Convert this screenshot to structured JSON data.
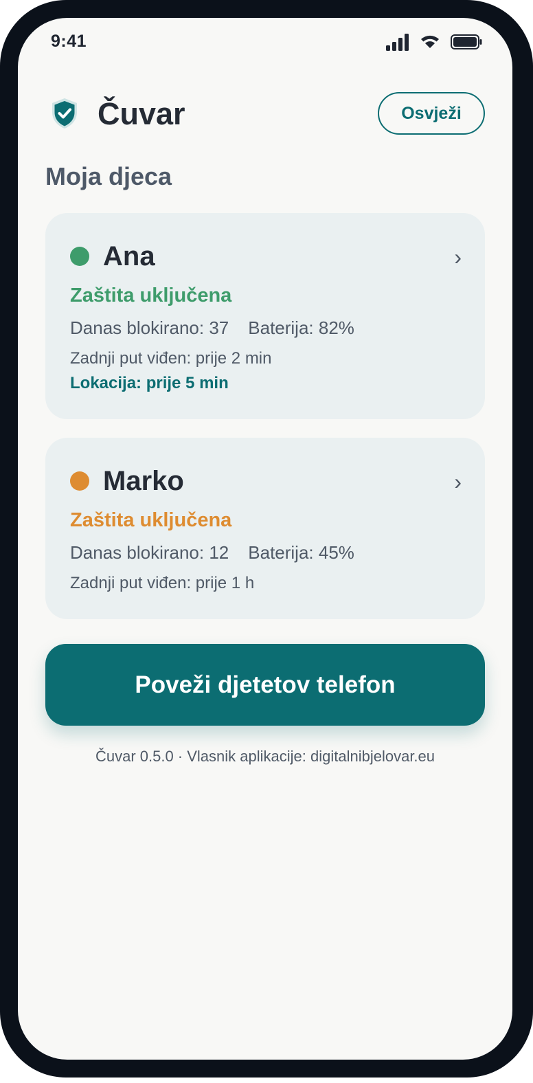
{
  "status_bar": {
    "time": "9:41",
    "icons": [
      "signal-icon",
      "wifi-icon",
      "battery-icon"
    ]
  },
  "header": {
    "logo_icon": "shield-check-icon",
    "app_title": "Čuvar",
    "refresh_label": "Osvježi"
  },
  "section_title": "Moja djeca",
  "children": [
    {
      "name": "Ana",
      "status_color": "#3e9c6b",
      "protection": "Zaštita uključena",
      "blocked": "Danas blokirano: 37",
      "battery": "Baterija: 82%",
      "last_seen": "Zadnji put viđen: prije 2 min",
      "location": "Lokacija: prije 5 min"
    },
    {
      "name": "Marko",
      "status_color": "#de8c31",
      "protection": "Zaštita uključena",
      "blocked": "Danas blokirano: 12",
      "battery": "Baterija: 45%",
      "last_seen": "Zadnji put viđen: prije 1 h"
    }
  ],
  "connect_button_label": "Poveži djetetov telefon",
  "footer_text": "Čuvar 0.5.0 · Vlasnik aplikacije: digitalnibjelovar.eu",
  "colors": {
    "accent": "#0c6d72",
    "card_background": "#eaf0f1",
    "screen_background": "#f8f8f6",
    "frame": "#0b111a"
  }
}
